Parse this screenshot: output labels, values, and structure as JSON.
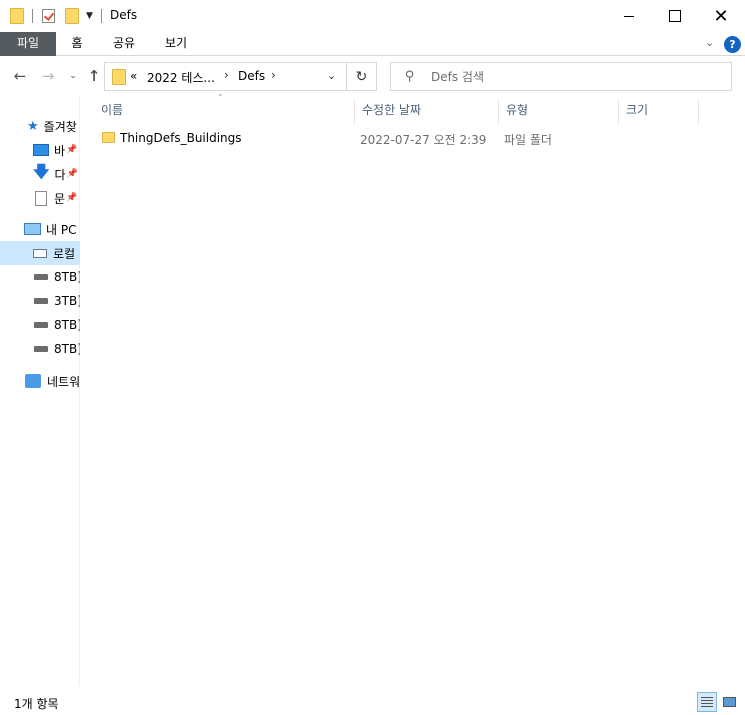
{
  "window": {
    "title": "Defs"
  },
  "ribbon": {
    "tabs": [
      "파일",
      "홈",
      "공유",
      "보기"
    ],
    "help": "?"
  },
  "address": {
    "overflow": "«",
    "crumbs": [
      "2022 테스...",
      "Defs"
    ]
  },
  "search": {
    "placeholder": "Defs 검색"
  },
  "sidebar": {
    "quick_access": "즐겨찾",
    "pinned": [
      {
        "label": "바",
        "icon": "desktop-icon"
      },
      {
        "label": "다",
        "icon": "download-icon"
      },
      {
        "label": "문",
        "icon": "document-icon"
      }
    ],
    "this_pc": "내 PC",
    "drives": [
      {
        "label": "로컬",
        "icon": "local-disk-icon",
        "selected": true
      },
      {
        "label": "8TB]",
        "icon": "drive-icon"
      },
      {
        "label": "3TB]",
        "icon": "drive-icon"
      },
      {
        "label": "8TB]",
        "icon": "drive-icon"
      },
      {
        "label": "8TB]",
        "icon": "drive-icon"
      }
    ],
    "network": "네트워"
  },
  "columns": {
    "name": "이름",
    "modified": "수정한 날짜",
    "type": "유형",
    "size": "크기"
  },
  "files": [
    {
      "name": "ThingDefs_Buildings",
      "modified": "2022-07-27 오전 2:39",
      "type": "파일 폴더",
      "size": ""
    }
  ],
  "status": {
    "count": "1개 항목"
  },
  "colors": {
    "file_tab": "#555a5f",
    "selection": "#cce8ff",
    "folder": "#ffd966",
    "help": "#1665c1"
  }
}
